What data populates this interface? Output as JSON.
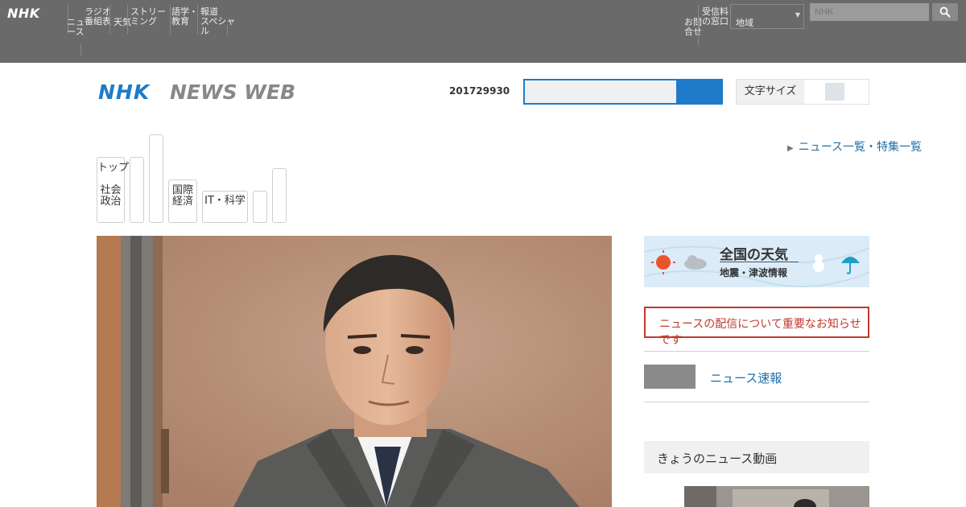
{
  "global_bar": {
    "logo": "NHK",
    "nav_items": [
      "ニュ\nース",
      "ラジオ\n番組表",
      "天気",
      "ストリー\nミング",
      "語学・\n教育",
      "報道\nスペシャ\nル"
    ],
    "right_items": [
      "お問\n合せ",
      "受信料\nの窓口"
    ],
    "select_value": "地域",
    "search_placeholder": "NHK"
  },
  "header": {
    "logo_nhk": "NHK",
    "logo_text": "NEWS WEB",
    "date_code": "201729930",
    "toggle_label": "文字サイズ"
  },
  "tabs": [
    {
      "label": "トップ\n\n社会\n政治"
    },
    {
      "label": ""
    },
    {
      "label": ""
    },
    {
      "label": "国際\n経済"
    },
    {
      "label": "IT・科学"
    },
    {
      "label": ""
    },
    {
      "label": ""
    }
  ],
  "external_link": "ニュース一覧・特集一覧",
  "weather_banner": {
    "title": "全国の天気",
    "subtitle": "地震・津波情報"
  },
  "alert_text": "ニュースの配信について重要なお知らせです",
  "side_link": "ニュース速報",
  "panel_heading": "きょうのニュース動画"
}
